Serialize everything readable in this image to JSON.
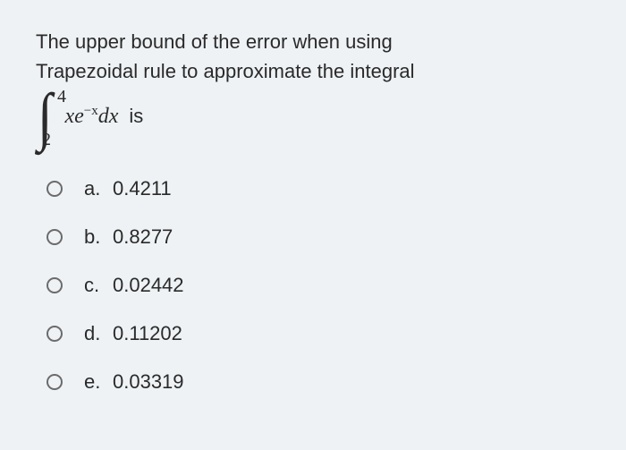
{
  "question": {
    "line1": "The upper bound of the error when using",
    "line2": "Trapezoidal rule to approximate the integral",
    "integral": {
      "upper": "4",
      "lower": "2",
      "integrand_x1": "xe",
      "integrand_exp": "−x",
      "integrand_dx": "dx",
      "trailing": "is"
    }
  },
  "options": [
    {
      "letter": "a.",
      "value": "0.4211"
    },
    {
      "letter": "b.",
      "value": "0.8277"
    },
    {
      "letter": "c.",
      "value": "0.02442"
    },
    {
      "letter": "d.",
      "value": "0.11202"
    },
    {
      "letter": "e.",
      "value": "0.03319"
    }
  ]
}
